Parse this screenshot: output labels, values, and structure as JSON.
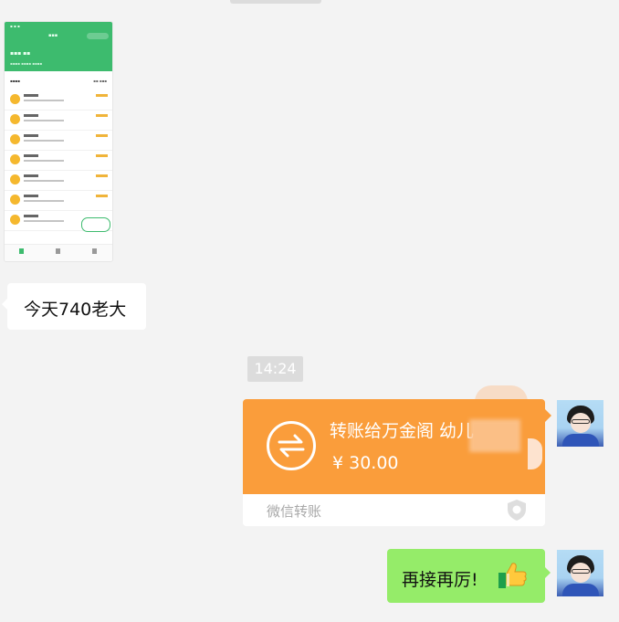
{
  "chat": {
    "incoming_text": "今天740老大",
    "timestamp": "14:24",
    "transfer": {
      "title": "转账给万金阁 幼儿",
      "amount": "¥ 30.00",
      "footer": "微信转账"
    },
    "outgoing_text": "再接再厉!",
    "outgoing_emoji": "thumbs-up-icon"
  },
  "screenshot_thumbnail": {
    "header_color": "#3dbb6e"
  },
  "colors": {
    "transfer_orange": "#fa9d3b",
    "bubble_green": "#95ec69",
    "background": "#f3f3f3"
  }
}
